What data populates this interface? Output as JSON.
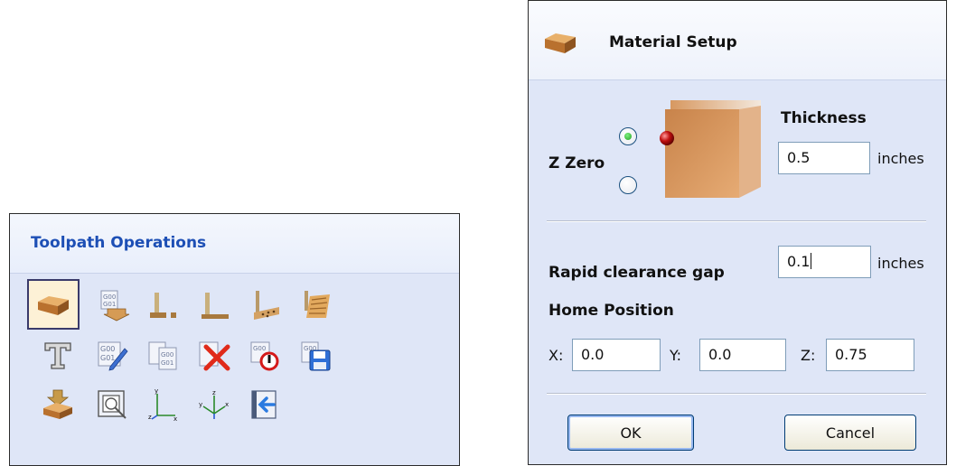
{
  "toolpath_ops": {
    "title": "Toolpath Operations",
    "icons": [
      [
        "material-setup-icon",
        "gcode-import-icon",
        "profile-toolpath-icon",
        "pocket-toolpath-icon",
        "drill-toolpath-icon",
        "texture-toolpath-icon"
      ],
      [
        "vcarve-icon",
        "edit-toolpath-icon",
        "merge-toolpaths-icon",
        "delete-toolpath-icon",
        "preview-toolpath-icon",
        "save-toolpath-icon"
      ],
      [
        "fluting-icon",
        "toolpath-summary-icon",
        "xy-datum-icon",
        "xyz-datum-icon",
        "exit-icon"
      ]
    ]
  },
  "material_setup": {
    "title": "Material Setup",
    "thickness_label": "Thickness",
    "thickness_value": "0.5",
    "thickness_units": "inches",
    "z_zero_label": "Z Zero",
    "z_zero_selected": "top",
    "rapid_label": "Rapid clearance gap",
    "rapid_value": "0.1",
    "rapid_units": "inches",
    "home_label": "Home Position",
    "x_label": "X:",
    "x_value": "0.0",
    "y_label": "Y:",
    "y_value": "0.0",
    "z_label": "Z:",
    "z_value": "0.75",
    "ok_label": "OK",
    "cancel_label": "Cancel"
  },
  "colors": {
    "panel_bg": "#dfe6f7",
    "title_blue": "#1d4fb5",
    "wood": "#c98a4a"
  }
}
